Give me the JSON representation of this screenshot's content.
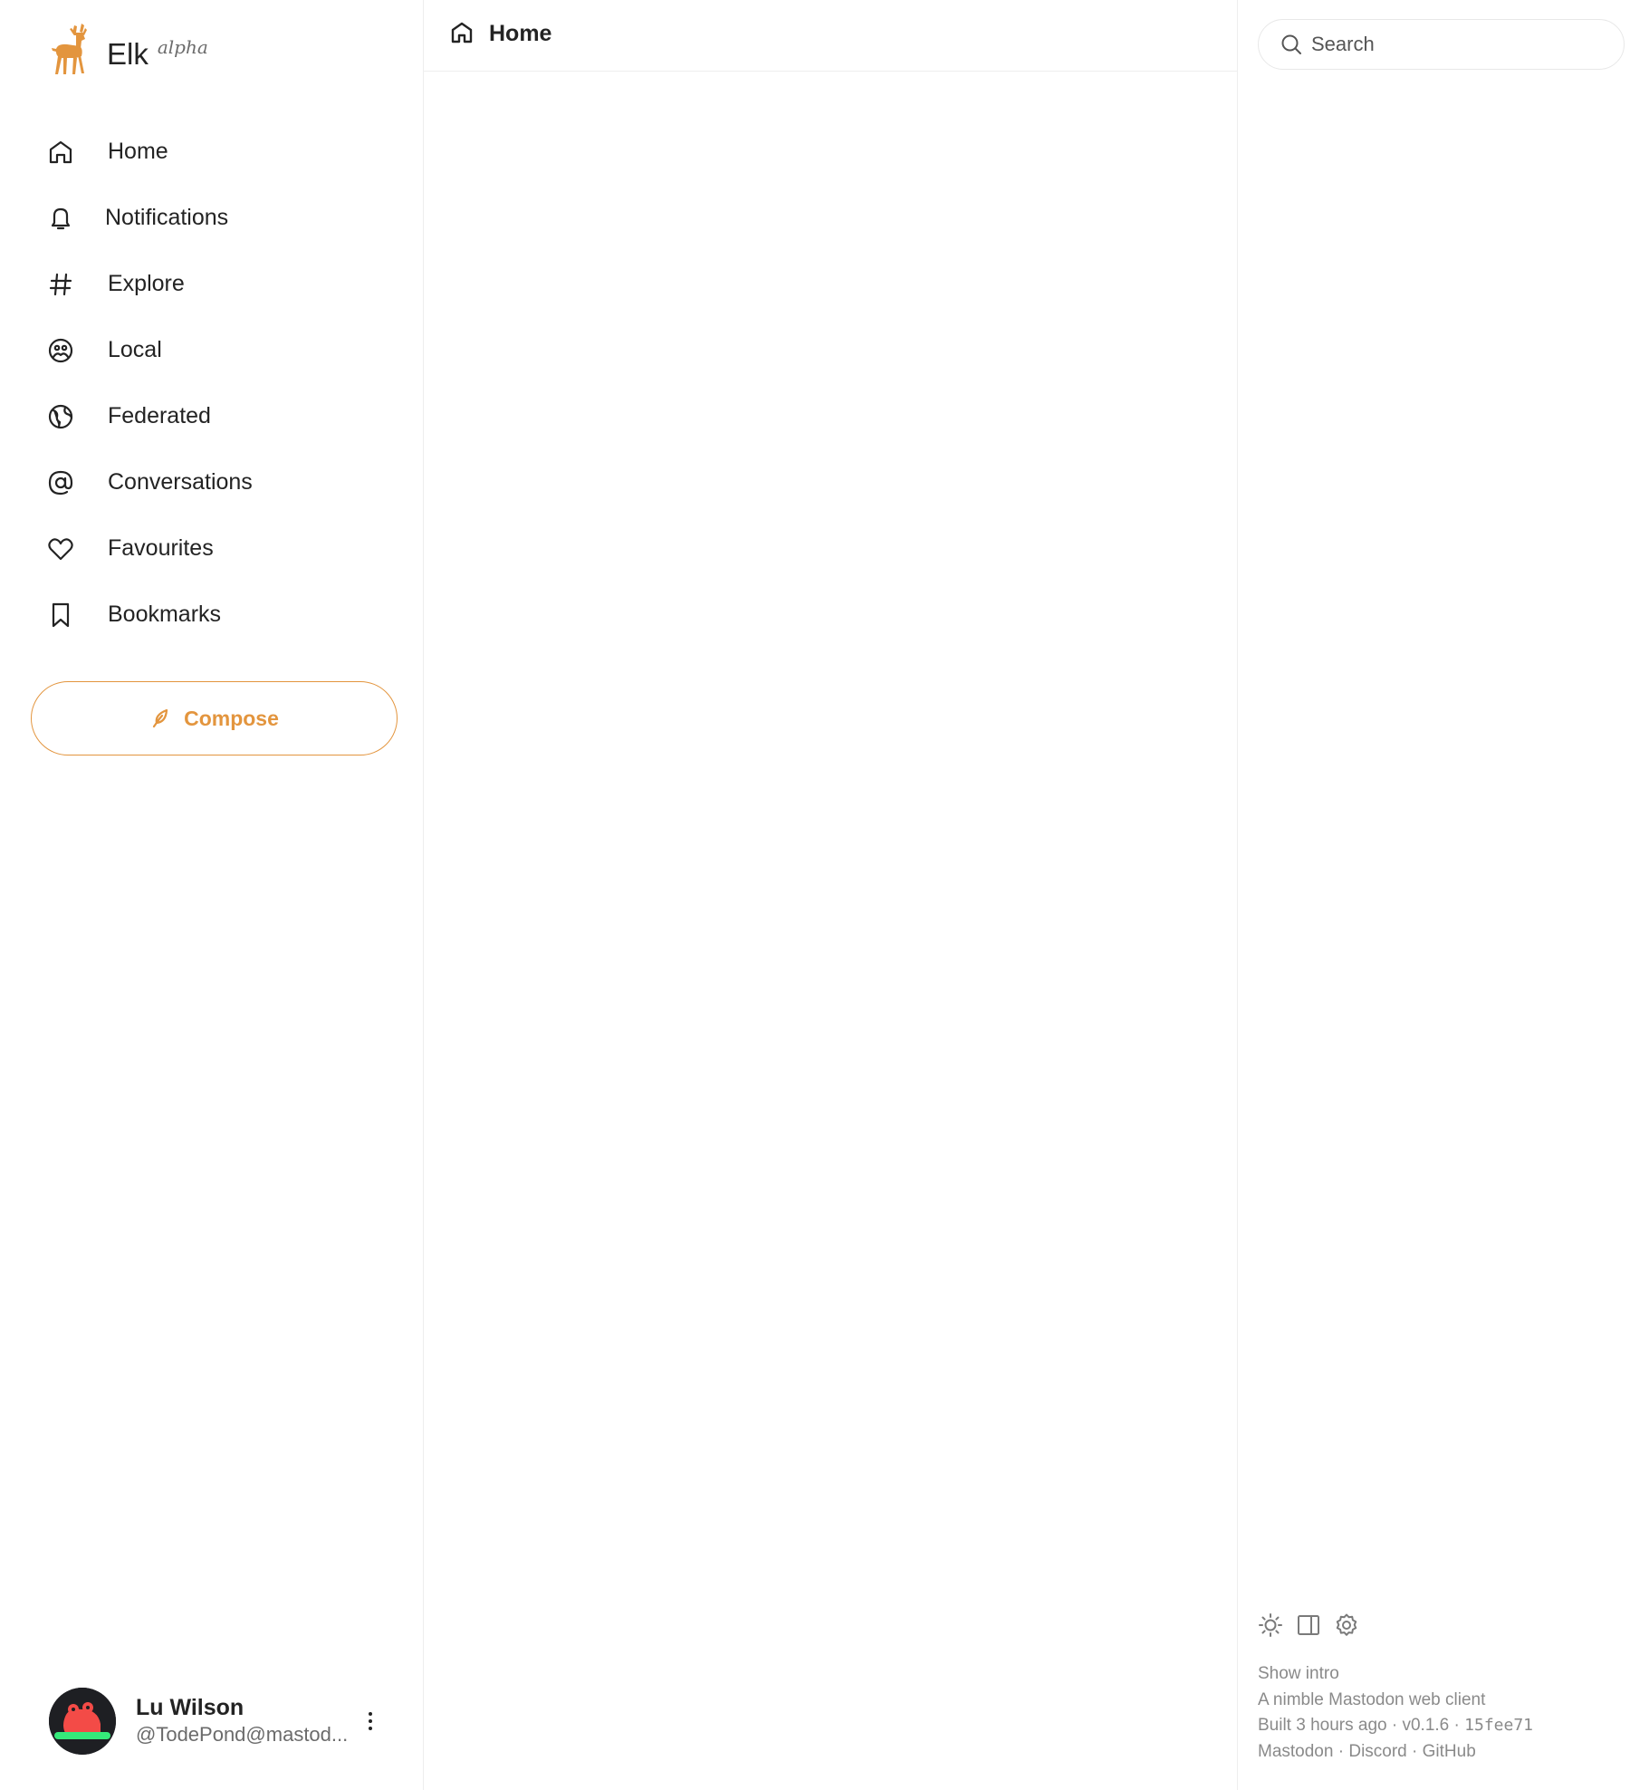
{
  "brand": {
    "name": "Elk",
    "tag": "alpha",
    "accent": "#e3953e"
  },
  "nav": {
    "items": [
      {
        "label": "Home",
        "icon": "home-icon"
      },
      {
        "label": "Notifications",
        "icon": "bell-icon"
      },
      {
        "label": "Explore",
        "icon": "hashtag-icon"
      },
      {
        "label": "Local",
        "icon": "group-icon"
      },
      {
        "label": "Federated",
        "icon": "globe-icon"
      },
      {
        "label": "Conversations",
        "icon": "at-icon"
      },
      {
        "label": "Favourites",
        "icon": "heart-icon"
      },
      {
        "label": "Bookmarks",
        "icon": "bookmark-icon"
      }
    ]
  },
  "compose": {
    "label": "Compose"
  },
  "user": {
    "name": "Lu Wilson",
    "handle": "@TodePond@mastod..."
  },
  "main": {
    "title": "Home"
  },
  "search": {
    "placeholder": "Search"
  },
  "footer": {
    "show_intro": "Show intro",
    "tagline": "A nimble Mastodon web client",
    "built": "Built 3 hours ago",
    "separator": "·",
    "version": "v0.1.6",
    "commit": "15fee71",
    "links": [
      "Mastodon",
      "Discord",
      "GitHub"
    ]
  }
}
